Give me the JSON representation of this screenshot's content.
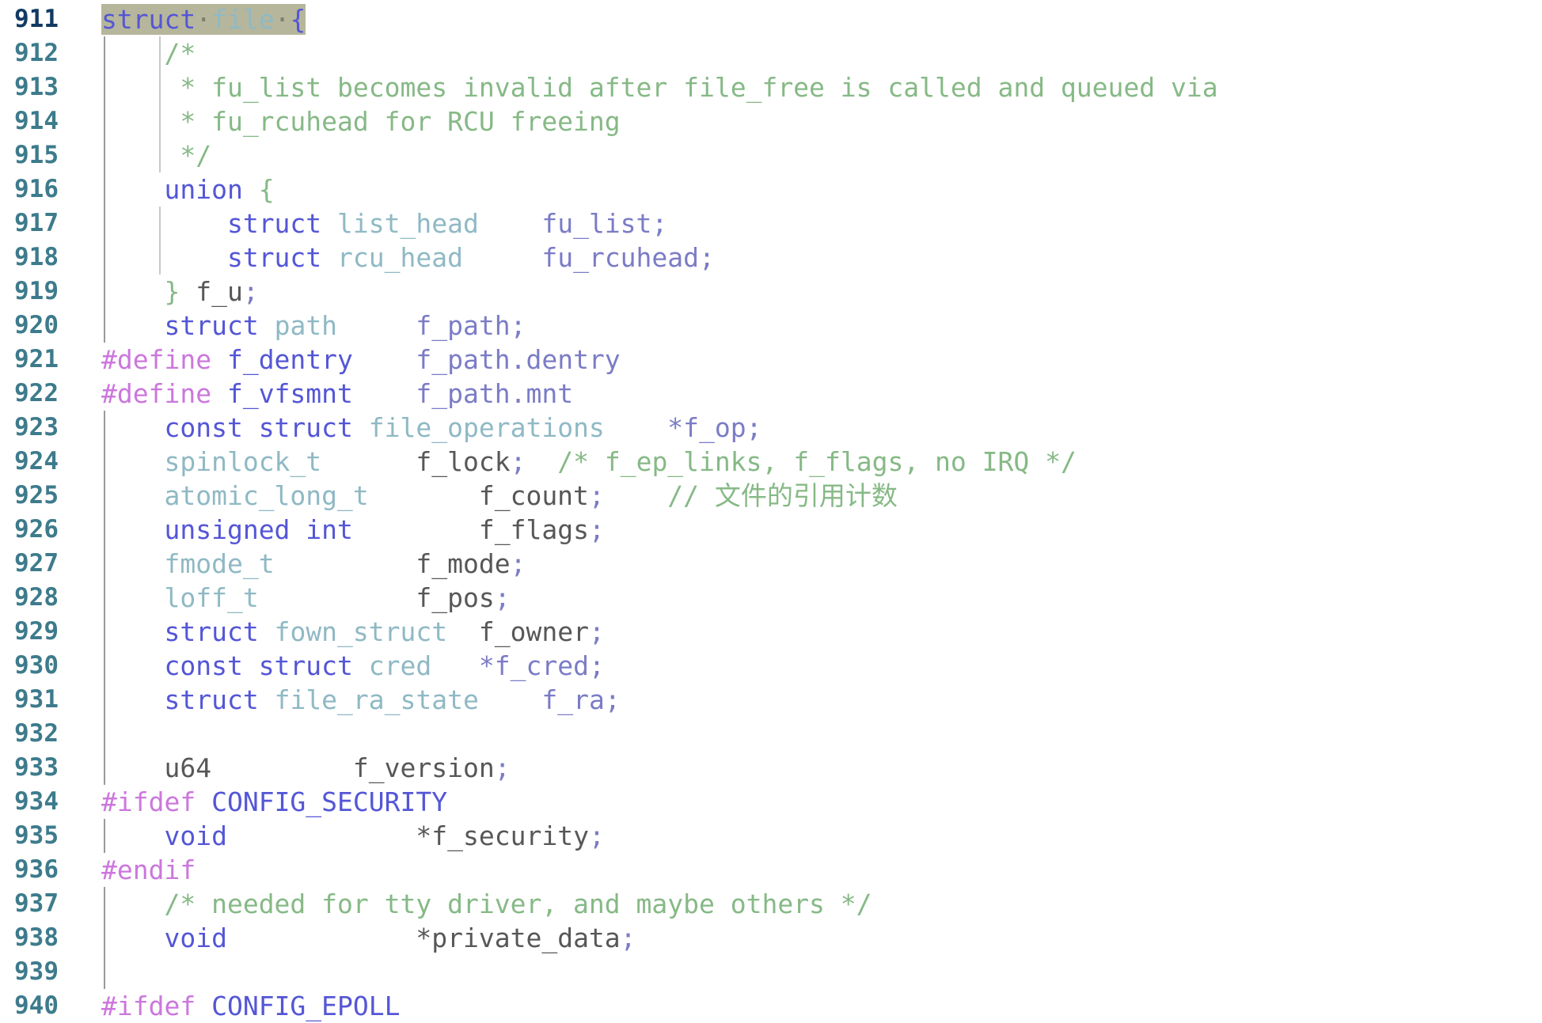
{
  "editor": {
    "kind": "code-editor",
    "language": "C",
    "first_line_number": 911,
    "last_line_number": 940,
    "selection_line": 911,
    "whitespace_marker": "·",
    "colors": {
      "background": "#ffffff",
      "line_number": "#3d7b8c",
      "line_number_active": "#123a63",
      "keyword": "#5456d6",
      "type": "#8fb9c4",
      "identifier": "#7b7cc6",
      "comment": "#86b986",
      "preprocessor": "#cc77dd",
      "plain_text": "#575757",
      "selection": "#b6b69c",
      "indent_guide": "#c9c9c9",
      "indent_guide_root": "#9a9a9a"
    }
  },
  "lines": [
    {
      "num": "911",
      "text": "struct file {"
    },
    {
      "num": "912",
      "text": "    /*"
    },
    {
      "num": "913",
      "text": "     * fu_list becomes invalid after file_free is called and queued via"
    },
    {
      "num": "914",
      "text": "     * fu_rcuhead for RCU freeing"
    },
    {
      "num": "915",
      "text": "     */"
    },
    {
      "num": "916",
      "text": "    union {"
    },
    {
      "num": "917",
      "text": "        struct list_head    fu_list;"
    },
    {
      "num": "918",
      "text": "        struct rcu_head     fu_rcuhead;"
    },
    {
      "num": "919",
      "text": "    } f_u;"
    },
    {
      "num": "920",
      "text": "    struct path     f_path;"
    },
    {
      "num": "921",
      "text": "#define f_dentry    f_path.dentry"
    },
    {
      "num": "922",
      "text": "#define f_vfsmnt    f_path.mnt"
    },
    {
      "num": "923",
      "text": "    const struct file_operations    *f_op;"
    },
    {
      "num": "924",
      "text": "    spinlock_t      f_lock;  /* f_ep_links, f_flags, no IRQ */"
    },
    {
      "num": "925",
      "text": "    atomic_long_t       f_count;    // 文件的引用计数"
    },
    {
      "num": "926",
      "text": "    unsigned int        f_flags;"
    },
    {
      "num": "927",
      "text": "    fmode_t         f_mode;"
    },
    {
      "num": "928",
      "text": "    loff_t          f_pos;"
    },
    {
      "num": "929",
      "text": "    struct fown_struct  f_owner;"
    },
    {
      "num": "930",
      "text": "    const struct cred   *f_cred;"
    },
    {
      "num": "931",
      "text": "    struct file_ra_state    f_ra;"
    },
    {
      "num": "932",
      "text": ""
    },
    {
      "num": "933",
      "text": "    u64         f_version;"
    },
    {
      "num": "934",
      "text": "#ifdef CONFIG_SECURITY"
    },
    {
      "num": "935",
      "text": "    void            *f_security;"
    },
    {
      "num": "936",
      "text": "#endif"
    },
    {
      "num": "937",
      "text": "    /* needed for tty driver, and maybe others */"
    },
    {
      "num": "938",
      "text": "    void            *private_data;"
    },
    {
      "num": "939",
      "text": ""
    },
    {
      "num": "940",
      "text": "#ifdef CONFIG_EPOLL"
    }
  ],
  "tokens": {
    "l911": {
      "kw": "struct",
      "type": "file",
      "brace": "{"
    },
    "l912": {
      "comment": "/*"
    },
    "l913": {
      "comment": "* fu_list becomes invalid after file_free is called and queued via"
    },
    "l914": {
      "comment": "* fu_rcuhead for RCU freeing"
    },
    "l915": {
      "comment": "*/"
    },
    "l916": {
      "kw": "union",
      "brace": "{"
    },
    "l917": {
      "kw": "struct",
      "type": "list_head",
      "name": "fu_list;"
    },
    "l918": {
      "kw": "struct",
      "type": "rcu_head",
      "name": "fu_rcuhead;"
    },
    "l919": {
      "brace": "}",
      "name": "f_u;"
    },
    "l920": {
      "kw": "struct",
      "type": "path",
      "name": "f_path;"
    },
    "l921": {
      "pre": "#define",
      "macro": "f_dentry",
      "value": "f_path.dentry"
    },
    "l922": {
      "pre": "#define",
      "macro": "f_vfsmnt",
      "value": "f_path.mnt"
    },
    "l923": {
      "kw": "const struct",
      "type": "file_operations",
      "name": "*f_op;"
    },
    "l924": {
      "type": "spinlock_t",
      "name": "f_lock;",
      "comment": "/* f_ep_links, f_flags, no IRQ */"
    },
    "l925": {
      "type": "atomic_long_t",
      "name": "f_count;",
      "comment": "// 文件的引用计数"
    },
    "l926": {
      "kw": "unsigned int",
      "name": "f_flags;"
    },
    "l927": {
      "type": "fmode_t",
      "name": "f_mode;"
    },
    "l928": {
      "type": "loff_t",
      "name": "f_pos;"
    },
    "l929": {
      "kw": "struct",
      "type": "fown_struct",
      "name": "f_owner;"
    },
    "l930": {
      "kw": "const struct",
      "type": "cred",
      "name": "*f_cred;"
    },
    "l931": {
      "kw": "struct",
      "type": "file_ra_state",
      "name": "f_ra;"
    },
    "l933": {
      "plain": "u64",
      "name": "f_version;"
    },
    "l934": {
      "pre": "#ifdef",
      "macro": "CONFIG_SECURITY"
    },
    "l935": {
      "kw": "void",
      "name": "*f_security;"
    },
    "l936": {
      "pre": "#endif"
    },
    "l937": {
      "comment": "/* needed for tty driver, and maybe others */"
    },
    "l938": {
      "kw": "void",
      "name": "*private_data;"
    },
    "l940": {
      "pre": "#ifdef",
      "macro": "CONFIG_EPOLL"
    }
  }
}
